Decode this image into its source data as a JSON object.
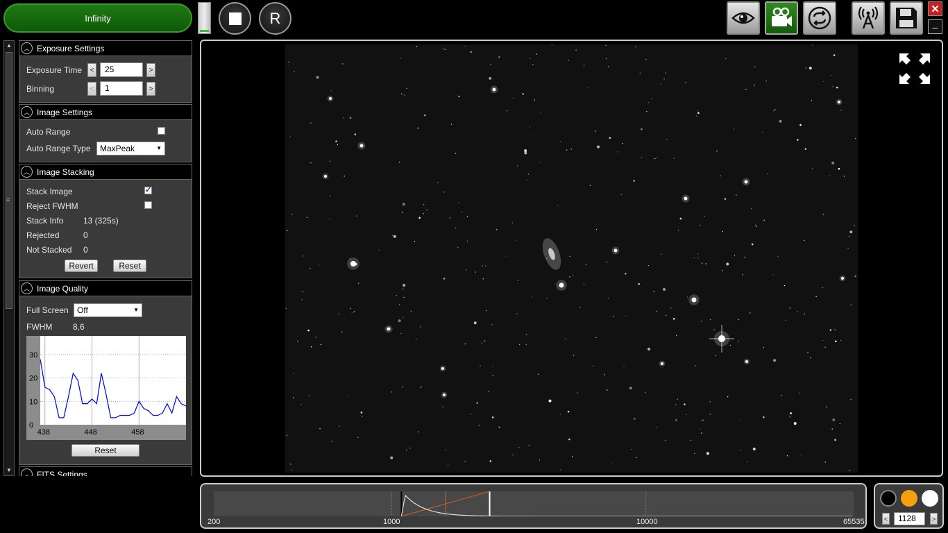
{
  "top": {
    "status": "Infinity",
    "stop_icon": "stop-icon",
    "restart_label": "R",
    "tools": [
      "eye-icon",
      "camera-icon",
      "loop-icon",
      "antenna-icon",
      "save-icon"
    ],
    "close_label": "✕",
    "minimize_label": "–"
  },
  "exposure": {
    "title": "Exposure Settings",
    "time_label": "Exposure Time",
    "time_value": "25",
    "binning_label": "Binning",
    "binning_value": "1",
    "dec_label": "<",
    "inc_label": ">"
  },
  "image_settings": {
    "title": "Image Settings",
    "auto_range_label": "Auto Range",
    "auto_range_checked": false,
    "auto_range_type_label": "Auto Range Type",
    "auto_range_type_value": "MaxPeak"
  },
  "stacking": {
    "title": "Image Stacking",
    "stack_image_label": "Stack Image",
    "stack_image_checked": true,
    "check_mark": "✓",
    "reject_fwhm_label": "Reject FWHM",
    "reject_fwhm_checked": false,
    "stack_info_label": "Stack Info",
    "stack_info_value": "13 (325s)",
    "rejected_label": "Rejected",
    "rejected_value": "0",
    "not_stacked_label": "Not Stacked",
    "not_stacked_value": "0",
    "revert_label": "Revert",
    "reset_label": "Reset"
  },
  "quality": {
    "title": "Image Quality",
    "full_screen_label": "Full Screen",
    "full_screen_value": "Off",
    "fwhm_label": "FWHM",
    "fwhm_value": "8,6",
    "reset_label": "Reset"
  },
  "fits": {
    "title": "FITS Settings"
  },
  "chart_data": {
    "type": "line",
    "title": "",
    "xlabel": "",
    "ylabel": "",
    "xlim": [
      437,
      468
    ],
    "ylim": [
      0,
      38
    ],
    "x_ticks": [
      438,
      448,
      458
    ],
    "y_ticks": [
      0,
      10,
      20,
      30
    ],
    "grid": true,
    "color": "#0a14d8",
    "series": [
      {
        "x": [
          437,
          438,
          439,
          440,
          441,
          442,
          443,
          444,
          445,
          446,
          447,
          448,
          449,
          450,
          451,
          452,
          453,
          454,
          455,
          456,
          457,
          458,
          459,
          460,
          461,
          462,
          463,
          464,
          465,
          466,
          467,
          468
        ],
        "values": [
          28,
          16,
          15,
          12,
          3,
          3,
          12,
          22,
          19,
          9,
          9,
          11,
          9,
          22,
          13,
          3,
          3,
          4,
          4,
          4,
          5,
          10,
          7,
          6,
          4,
          4,
          5,
          9,
          5,
          12,
          9,
          8
        ]
      }
    ]
  },
  "histogram": {
    "labels": [
      "200",
      "1000",
      "10000",
      "65535"
    ],
    "black_point": 1093,
    "white_point": 2430
  },
  "color_controls": {
    "colors": [
      "#000000",
      "#f5a00f",
      "#ffffff"
    ],
    "value": "1128",
    "dec_label": "<",
    "inc_label": ">"
  }
}
